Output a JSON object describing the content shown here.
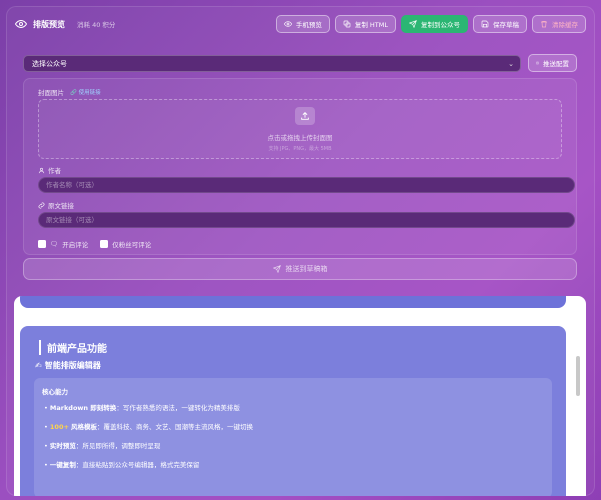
{
  "header": {
    "title": "排版预览",
    "subtitle": "消耗 40 积分",
    "buttons": {
      "mobile_preview": "手机预览",
      "copy_html": "复制 HTML",
      "copy_to_mp": "复制到公众号",
      "save_draft": "保存草稿",
      "clear_cache": "清除缓存"
    }
  },
  "account": {
    "select_label": "选择公众号",
    "config_button": "推送配置"
  },
  "form": {
    "cover_label": "封面图片",
    "cover_link": "使用链接",
    "upload_text": "点击或拖拽上传封面图",
    "upload_hint": "支持 JPG、PNG，最大 5MB",
    "author_label": "作者",
    "author_placeholder": "作者名称（可选）",
    "original_label": "原文链接",
    "original_placeholder": "原文链接（可选）",
    "open_comment": "开启评论",
    "fans_only": "仅粉丝可评论"
  },
  "push_button": "推送到草稿箱",
  "preview": {
    "heading": "前端产品功能",
    "subheading": "智能排版编辑器",
    "subheading_emoji": "✍",
    "section_title": "核心能力",
    "bullets": [
      {
        "bold": "Markdown 即刻转换",
        "text": "：写作者熟悉的语法，一键转化为精美排版",
        "highlight": ""
      },
      {
        "bold": "风格模板",
        "text": "：覆盖科技、商务、文艺、国潮等主流风格，一键切换",
        "highlight": "100+"
      },
      {
        "bold": "实时预览",
        "text": "：所见即所得，调整即时呈现",
        "highlight": ""
      },
      {
        "bold": "一键复制",
        "text": "：直接粘贴到公众号编辑器，格式完美保留",
        "highlight": ""
      }
    ]
  },
  "colors": {
    "accent_green": "#2bb673",
    "preview_card": "#7c7fdc",
    "highlight_yellow": "#ffd44a"
  }
}
